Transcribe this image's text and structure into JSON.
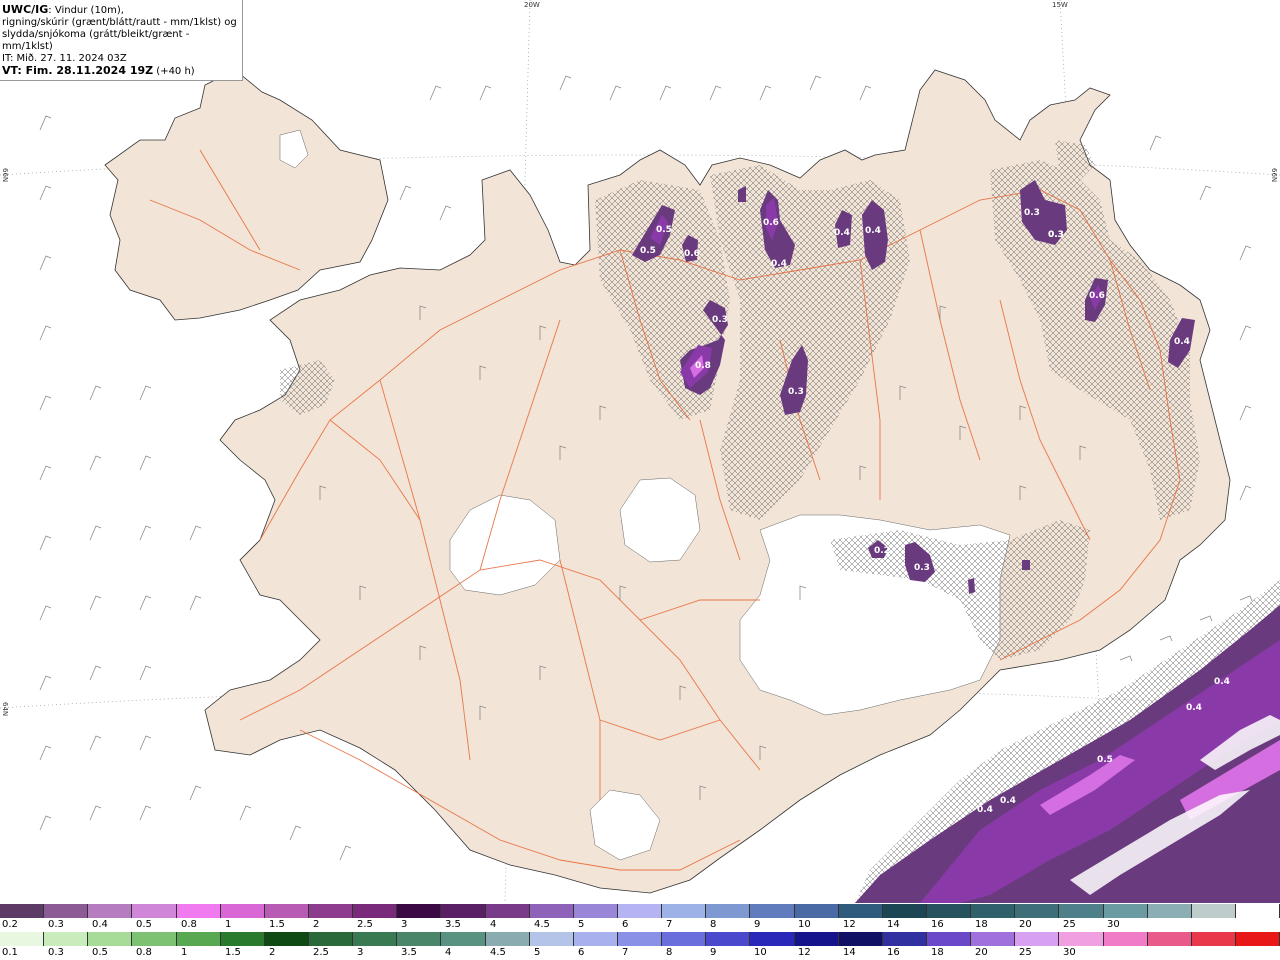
{
  "header": {
    "line1_bold": "UWC/IG",
    "line1_rest": ": Vindur (10m),",
    "line2": "rigning/skúrir (grænt/blátt/rautt - mm/1klst) og",
    "line3": "slydda/snjókoma (grátt/bleikt/grænt - mm/1klst)",
    "line4": "IT: Mið. 27. 11. 2024 03Z",
    "line5_bold": "VT: Fim. 28.11.2024 19Z",
    "line5_rest": " (+40 h)"
  },
  "coords": {
    "top_20w": "20W",
    "top_15w": "15W",
    "left_66n": "66N",
    "right_66n": "66N",
    "left_64n": "64N"
  },
  "map_values": [
    "0.5",
    "0.5",
    "0.6",
    "0.6",
    "0.4",
    "0.4",
    "0.4",
    "0.3",
    "0.3",
    "0.3",
    "0.6",
    "0.4",
    "0.3",
    "0.8",
    "0.3",
    "0.2",
    "0.3",
    "0.4",
    "0.4",
    "0.5",
    "0.4",
    "0.4"
  ],
  "colors": {
    "land": "#f2e4d6",
    "roads": "#e8693a",
    "sea": "#ffffff",
    "precip_dark": "#5b3a6e",
    "precip_mid": "#8a3aa8",
    "precip_light": "#d56ee0"
  },
  "snow_scale": {
    "colors": [
      "#5c3c66",
      "#8c5a95",
      "#b57cc0",
      "#cf86d8",
      "#f07af0",
      "#d968d6",
      "#b85bb5",
      "#8e3c8e",
      "#7a2a7a",
      "#3b0a45",
      "#5a2066",
      "#7a3a8a",
      "#8e62b8",
      "#9a86d6",
      "#b4b4f2",
      "#9db2e6",
      "#7e98d2",
      "#607cbc",
      "#4a6aa6",
      "#2f5c7c",
      "#1c4654",
      "#27535e",
      "#30606a",
      "#3e6e78",
      "#4f808a",
      "#6a9aa2",
      "#8aaeb4",
      "#bfcccc",
      "#ffffff"
    ],
    "labels": [
      "0.2",
      "0.3",
      "0.4",
      "0.5",
      "0.8",
      "1",
      "1.5",
      "2",
      "2.5",
      "3",
      "3.5",
      "4",
      "4.5",
      "5",
      "6",
      "7",
      "8",
      "9",
      "10",
      "12",
      "14",
      "16",
      "18",
      "20",
      "25",
      "30"
    ]
  },
  "rain_scale": {
    "colors": [
      "#e8f8e0",
      "#c8ecbc",
      "#a6dc98",
      "#7cc272",
      "#58a852",
      "#2a7a2e",
      "#0f4a14",
      "#2a6a3a",
      "#3a7a52",
      "#4a866a",
      "#5a9282",
      "#8aacb0",
      "#b4c4e8",
      "#a8b0ee",
      "#8a90e6",
      "#6a6edc",
      "#4a48cc",
      "#2a28b8",
      "#16148c",
      "#101064",
      "#3030a0",
      "#6a48c8",
      "#a070dc",
      "#d8a0f0",
      "#f0a0e0",
      "#f07cc8",
      "#e85a8a",
      "#e8384a",
      "#e81818"
    ],
    "labels": [
      "0.1",
      "0.3",
      "0.5",
      "0.8",
      "1",
      "1.5",
      "2",
      "2.5",
      "3",
      "3.5",
      "4",
      "4.5",
      "5",
      "6",
      "7",
      "8",
      "9",
      "10",
      "12",
      "14",
      "16",
      "18",
      "20",
      "25",
      "30"
    ]
  }
}
